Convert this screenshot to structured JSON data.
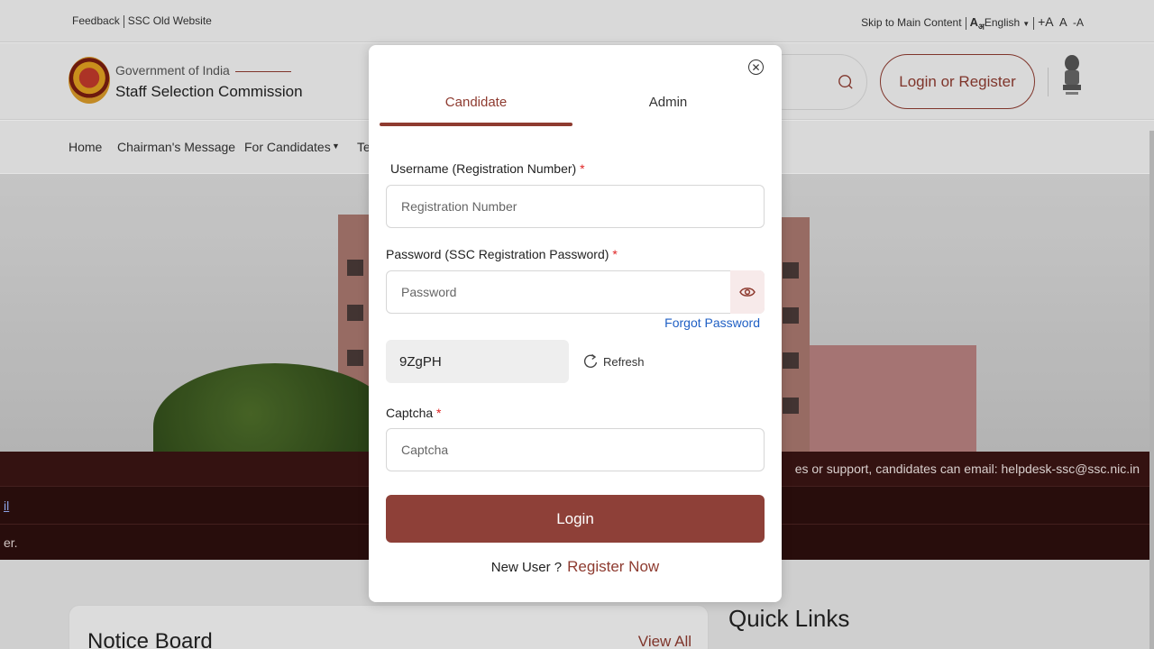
{
  "topbar": {
    "feedback": "Feedback",
    "old_site": "SSC Old Website",
    "skip": "Skip to Main Content",
    "lang": "English",
    "font_plus": "+A",
    "font_normal": "A",
    "font_minus": "-A"
  },
  "header": {
    "gov": "Government of India",
    "name": "Staff Selection Commission",
    "login_register": "Login or Register"
  },
  "nav": {
    "home": "Home",
    "chairman": "Chairman's Message",
    "candidates": "For Candidates",
    "partial": "Te"
  },
  "tickers": {
    "email": "es or support, candidates can email: helpdesk-ssc@ssc.nic.in",
    "link": "il",
    "text": "er."
  },
  "lower": {
    "notice_board": "Notice Board",
    "view_all": "View All",
    "quick_links": "Quick Links"
  },
  "modal": {
    "tabs": {
      "candidate": "Candidate",
      "admin": "Admin"
    },
    "username_label": "Username (Registration Number)",
    "username_placeholder": "Registration Number",
    "password_label": "Password (SSC Registration Password)",
    "password_placeholder": "Password",
    "forgot": "Forgot Password",
    "captcha_code": "9ZgPH",
    "refresh": "Refresh",
    "captcha_label": "Captcha",
    "captcha_placeholder": "Captcha",
    "login": "Login",
    "new_user": "New User ?",
    "register": "Register Now",
    "required_mark": "*"
  },
  "colors": {
    "brand": "#8e3b30",
    "link": "#1f5fc4",
    "required": "#e02424"
  }
}
